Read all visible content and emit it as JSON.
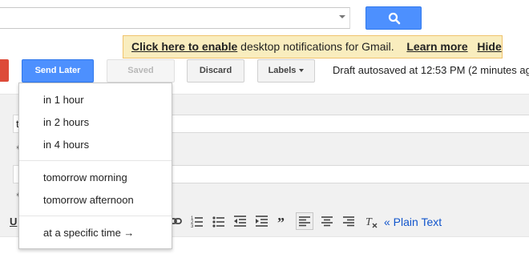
{
  "search": {
    "placeholder": ""
  },
  "notification": {
    "enable_link": "Click here to enable",
    "message": "desktop notifications for Gmail.",
    "learn_more": "Learn more",
    "hide": "Hide"
  },
  "toolbar": {
    "send_later": "Send Later",
    "saved": "Saved",
    "discard": "Discard",
    "labels": "Labels",
    "autosave_status": "Draft autosaved at 12:53 PM (2 minutes ag"
  },
  "compose": {
    "to_letter": "t",
    "plain_text": "« Plain Text",
    "underline": "U"
  },
  "send_later_menu": {
    "group1": [
      "in 1 hour",
      "in 2 hours",
      "in 4 hours"
    ],
    "group2": [
      "tomorrow morning",
      "tomorrow afternoon"
    ],
    "group3": [
      "at a specific time →"
    ]
  },
  "colors": {
    "accent_blue": "#4d90fe",
    "notify_bg": "#f9edbe",
    "link_blue": "#1155cc",
    "compose_red": "#dd4b39"
  }
}
